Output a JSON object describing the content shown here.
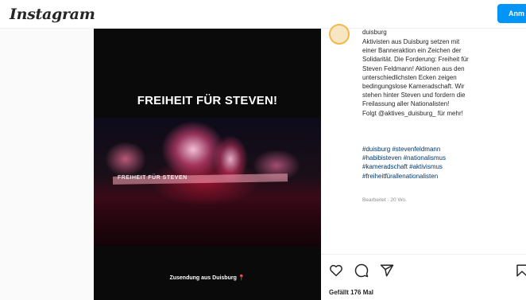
{
  "header": {
    "logo_text": "Instagram",
    "signup_label": "Anm"
  },
  "media": {
    "banner_title": "FREIHEIT FÜR STEVEN!",
    "banner_text": "FREIHEIT FÜR STEVEN",
    "caption": "Zusendung aus Duisburg",
    "caption_pin": "📍"
  },
  "post": {
    "username": "duisburg",
    "lines": [
      "Aktivisten aus Duisburg setzen mit",
      "einer Banneraktion ein Zeichen der",
      "Solidarität. Die Forderung: Freiheit für",
      "Steven Feldmann! Aktionen aus den",
      "unterschiedlichsten Ecken zeigen",
      "bedingungslose Kameradschaft. Wir",
      "stehen hinter Steven und fordern die",
      "Freilassung aller Nationalisten!",
      "Folgt @aktives_duisburg_ für mehr!"
    ],
    "hashtags": [
      "#duisburg #stevenfeldmann",
      "#habibisteven #nationalismus",
      "#kameradschaft #aktivismus",
      "#freiheitfürallenationalisten"
    ],
    "edited_label": "Bearbeitet · 20 Wo."
  },
  "actions": {
    "like_icon": "heart-icon",
    "comment_icon": "comment-icon",
    "share_icon": "send-icon",
    "save_icon": "bookmark-icon"
  },
  "likes_text": "Gefällt 176 Mal",
  "colors": {
    "accent": "#0095f6",
    "hashtag": "#00376b",
    "text": "#262626",
    "muted": "#8e8e8e"
  }
}
